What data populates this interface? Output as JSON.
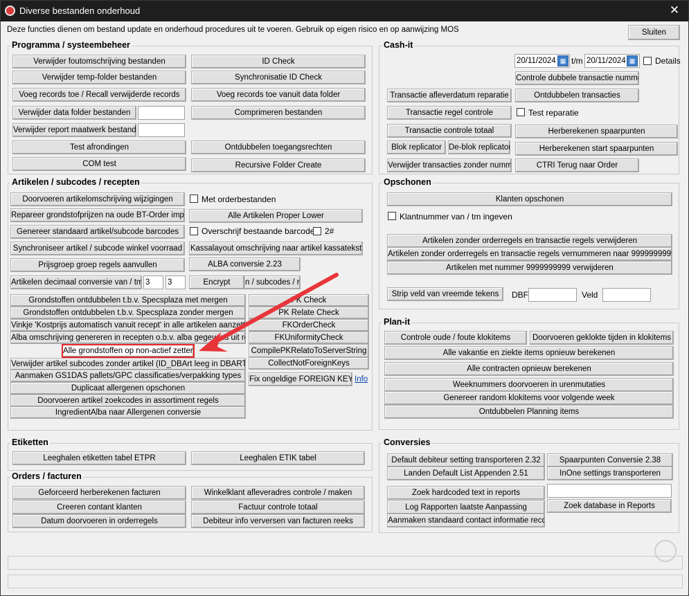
{
  "window": {
    "title": "Diverse bestanden onderhoud",
    "close": "✕"
  },
  "intro": "Deze functies dienen om bestand update en onderhoud procedures uit te voeren. Gebruik op eigen risico en op aanwijzing MOS",
  "sluiten": "Sluiten",
  "prog": {
    "label": "Programma / systeembeheer",
    "b1": "Verwijder foutomschrijving bestanden",
    "b2": "ID Check",
    "b3": "Verwijder temp-folder bestanden",
    "b4": "Synchronisatie ID Check",
    "b5": "Voeg records toe / Recall verwijderde records",
    "b6": "Voeg records toe vanuit data folder",
    "b7": "Verwijder data folder bestanden",
    "b8": "Comprimeren bestanden",
    "b9": "Verwijder report maatwerk bestanden",
    "b10": "Test afrondingen",
    "b11": "Ontdubbelen toegangsrechten",
    "b12": "COM test",
    "b13": "Recursive Folder Create",
    "in1": "",
    "in2": ""
  },
  "cash": {
    "label": "Cash-it",
    "date_from": "20/11/2024",
    "tm": "t/m",
    "date_to": "20/11/2024",
    "details": "Details",
    "b1": "Controle dubbele transactie nummers",
    "b2": "Transactie afleverdatum reparatie",
    "b3": "Ontdubbelen transacties",
    "b4": "Transactie regel controle",
    "test_rep": "Test reparatie",
    "b5": "Transactie controle totaal",
    "b6": "Herberekenen spaarpunten",
    "b7": "Blok replicator",
    "b8": "De-blok replicator",
    "b9": "Herberekenen start spaarpunten",
    "b10": "Verwijder transacties zonder nummer",
    "b11": "CTRI Terug naar Order"
  },
  "art": {
    "label": "Artikelen / subcodes / recepten",
    "b1": "Doorvoeren artikelomschrijving wijzigingen",
    "met_order": "Met orderbestanden",
    "b2": "Repareer grondstofprijzen na oude BT-Order import",
    "b3": "Alle Artikelen Proper Lower",
    "b4": "Genereer standaard artikel/subcode barcodes",
    "overschrijf": "Overschrijf bestaande barcodes",
    "twohash": "2#",
    "b5": "Synchroniseer artikel / subcode winkel voorraad",
    "b6": "Kassalayout omschrijving naar artikel kassatekst",
    "b7": "Prijsgroep groep regels aanvullen",
    "b8": "ALBA conversie 2.23",
    "b9": "Artikelen decimaal conversie van / tm",
    "v1": "3",
    "v2": "3",
    "b10": "Encrypt",
    "b11": "n / subcodes / re",
    "list": [
      "Grondstoffen ontdubbelen t.b.v. Specsplaza met mergen",
      "Grondstoffen ontdubbelen t.b.v. Specsplaza zonder mergen",
      "Vinkje 'Kostprijs automatisch vanuit recept' in alle artikelen aanzetten",
      "Alba omschrijving genereren in recepten o.b.v. alba gegevens uit recept",
      "Alle grondstoffen op non-actief zetten",
      "Verwijder artikel subcodes zonder artikel (ID_DBArt leeg in DBARTS)",
      "Aanmaken GS1DAS pallets/GPC classificaties/verpakking types",
      "Duplicaat allergenen opschonen",
      "Doorvoeren artikel zoekcodes in assortiment regels",
      "IngredientAlba naar Allergenen conversie"
    ],
    "right": [
      "FK Check",
      "PK Relate Check",
      "FKOrderCheck",
      "FKUniformityCheck",
      "CompilePKRelatoToServerString",
      "CollectNotForeignKeys"
    ],
    "fix": "Fix ongeldige FOREIGN KEYS",
    "info": "Info"
  },
  "ops": {
    "label": "Opschonen",
    "b1": "Klanten opschonen",
    "klantnr": "Klantnummer van / tm ingeven",
    "b2": "Artikelen zonder orderregels en transactie regels verwijderen",
    "b3": "Artikelen zonder orderregels en transactie regels vernummeren naar 9999999999",
    "b4": "Artikelen met nummer 9999999999 verwijderen",
    "b5": "Strip veld van vreemde tekens",
    "dbf": "DBF",
    "veld": "Veld",
    "in1": "",
    "in2": ""
  },
  "plan": {
    "label": "Plan-it",
    "b1": "Controle oude / foute klokitems",
    "b2": "Doorvoeren geklokte tijden in klokitems",
    "b3": "Alle vakantie en ziekte items opnieuw berekenen",
    "b4": "Alle contracten opnieuw berekenen",
    "b5": "Weeknummers doorvoeren in urenmutaties",
    "b6": "Genereer random klokitems voor volgende week",
    "b7": "Ontdubbelen Planning items"
  },
  "etik": {
    "label": "Etiketten",
    "b1": "Leeghalen etiketten tabel ETPR",
    "b2": "Leeghalen ETIK tabel"
  },
  "conv": {
    "label": "Conversies",
    "b1": "Default debiteur setting transporteren 2.32",
    "b2": "Spaarpunten Conversie 2.38",
    "b3": "Landen Default List Appenden 2.51",
    "b4": "InOne settings transporteren",
    "b5": "Zoek hardcoded text in reports",
    "b6": "Log Rapporten laatste Aanpassing",
    "b7": "Zoek database in Reports",
    "b8": "Aanmaken standaard contact informatie record",
    "in1": ""
  },
  "orders": {
    "label": "Orders / facturen",
    "b1": "Geforceerd herberekenen facturen",
    "b2": "Winkelklant afleveradres controle / maken",
    "b3": "Creeren contant klanten",
    "b4": "Factuur controle totaal",
    "b5": "Datum doorvoeren in orderregels",
    "b6": "Debiteur info verversen van facturen reeks"
  },
  "colors": {
    "highlight": "#e8262b",
    "arrow": "#e8353a"
  }
}
